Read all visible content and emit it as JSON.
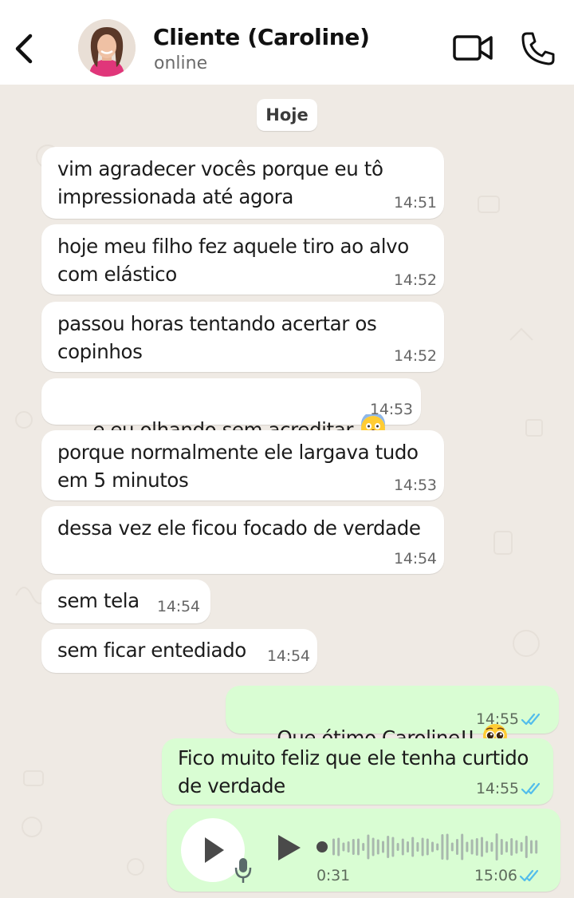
{
  "header": {
    "contact_name": "Cliente (Caroline)",
    "status": "online"
  },
  "chat": {
    "day_label": "Hoje",
    "messages": [
      {
        "direction": "in",
        "text": "vim agradecer vocês porque eu tô\nimpressionada até agora",
        "time": "14:51"
      },
      {
        "direction": "in",
        "text": "hoje meu filho fez aquele tiro ao alvo\ncom elástico",
        "time": "14:52"
      },
      {
        "direction": "in",
        "text": "passou horas tentando acertar os\ncopinhos",
        "time": "14:52"
      },
      {
        "direction": "in",
        "text": "e eu olhando sem acreditar",
        "emoji": "screaming-face-emoji",
        "time": "14:53"
      },
      {
        "direction": "in",
        "text": "porque normalmente ele largava tudo\nem 5 minutos",
        "time": "14:53"
      },
      {
        "direction": "in",
        "text": "dessa vez ele ficou focado de verdade",
        "time": "14:54"
      },
      {
        "direction": "in",
        "text": "sem tela",
        "time": "14:54"
      },
      {
        "direction": "in",
        "text": "sem ficar entediado",
        "time": "14:54"
      },
      {
        "direction": "out",
        "text": "Que ótimo Caroline!!",
        "emoji": "pleading-face-emoji",
        "time": "14:55",
        "read": true
      },
      {
        "direction": "out",
        "text": "Fico muito feliz que ele tenha curtido\nde verdade",
        "time": "14:55",
        "read": true
      },
      {
        "direction": "out",
        "type": "audio",
        "duration": "0:31",
        "time": "15:06",
        "read": true,
        "progress": 0.0
      }
    ]
  },
  "colors": {
    "incoming_bubble": "#ffffff",
    "outgoing_bubble": "#d9fdd3",
    "read_ticks": "#53bdeb",
    "chat_background": "#efeae4"
  }
}
